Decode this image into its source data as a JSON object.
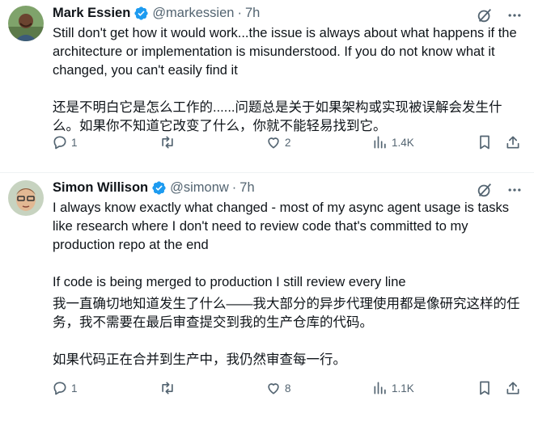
{
  "tweets": [
    {
      "name": "Mark Essien",
      "handle": "@markessien",
      "separator": "·",
      "time": "7h",
      "paragraphs": [
        "Still don't get how it would work...the issue is always about what happens if the architecture or implementation is misunderstood. If you do not know what it changed, you can't easily find it",
        "",
        "还是不明白它是怎么工作的......问题总是关于如果架构或实现被误解会发生什么。如果你不知道它改变了什么，你就不能轻易找到它。"
      ],
      "replies": "1",
      "reposts": "",
      "likes": "2",
      "views": "1.4K"
    },
    {
      "name": "Simon Willison",
      "handle": "@simonw",
      "separator": "·",
      "time": "7h",
      "paragraphs": [
        "I always know exactly what changed - most of my async agent usage is tasks like research where I don't need to review code that's committed to my production repo at the end",
        "",
        "If code is being merged to production I still review every line",
        "我一直确切地知道发生了什么——我大部分的异步代理使用都是像研究这样的任务，我不需要在最后审查提交到我的生产仓库的代码。",
        "",
        "如果代码正在合并到生产中，我仍然审查每一行。"
      ],
      "replies": "1",
      "reposts": "",
      "likes": "8",
      "views": "1.1K"
    }
  ],
  "icons": {
    "verified": "verified-badge-icon",
    "grok": "grok-icon",
    "more": "more-icon",
    "reply": "reply-icon",
    "repost": "repost-icon",
    "like": "like-icon",
    "views": "views-icon",
    "bookmark": "bookmark-icon",
    "share": "share-icon"
  },
  "colors": {
    "verified": "#1d9bf0",
    "secondary_text": "#536471",
    "divider": "#eff3f4"
  }
}
